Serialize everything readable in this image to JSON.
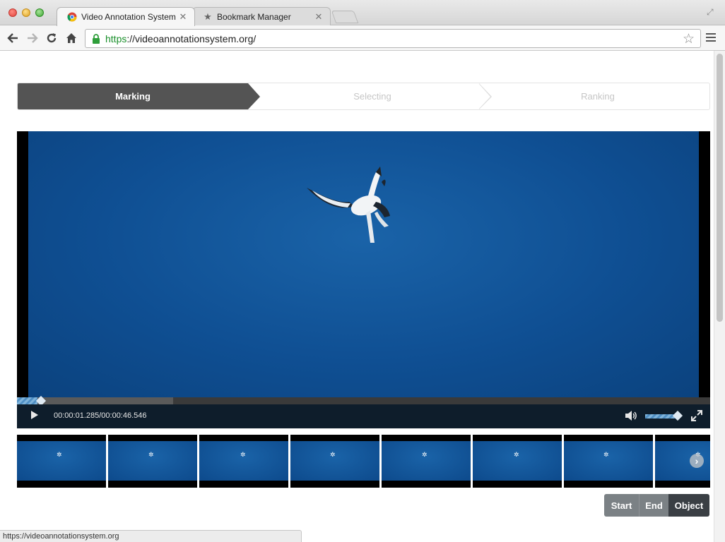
{
  "browser": {
    "tabs": [
      {
        "label": "Video Annotation System",
        "icon": "chrome-icon",
        "active": true
      },
      {
        "label": "Bookmark Manager",
        "icon": "star-icon",
        "active": false
      }
    ],
    "url_scheme": "https",
    "url_rest": "://videoannotationsystem.org/",
    "status_url": "https://videoannotationsystem.org"
  },
  "steps": [
    {
      "label": "Marking",
      "active": true
    },
    {
      "label": "Selecting",
      "active": false
    },
    {
      "label": "Ranking",
      "active": false
    }
  ],
  "player": {
    "timecode": "00:00:01.285/00:00:46.546",
    "progress_played_fraction": 0.03,
    "progress_buffered_fraction": 0.225,
    "volume_fraction": 0.85,
    "colors": {
      "sky": "#0f4f93",
      "controls_bg": "#0e1d2b",
      "progress": "#4f8fc4"
    }
  },
  "thumbnails": {
    "count": 8,
    "next_icon": "chevron-right-icon"
  },
  "actions": {
    "start_label": "Start",
    "end_label": "End",
    "object_label": "Object"
  }
}
